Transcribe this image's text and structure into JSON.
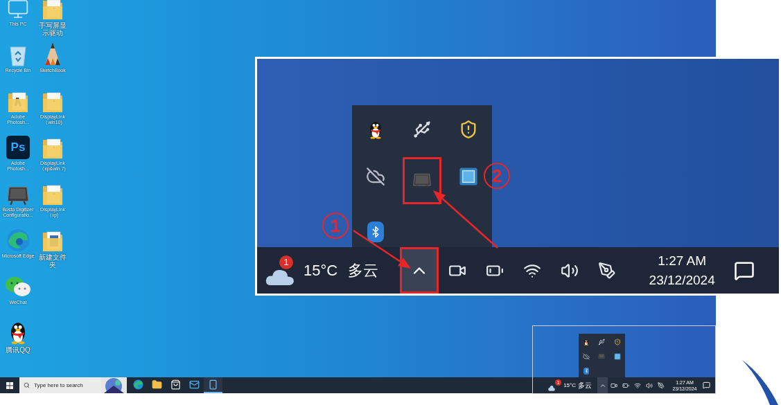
{
  "desktop": {
    "columns": [
      [
        {
          "kind": "pc",
          "label": "This PC"
        },
        {
          "kind": "bin",
          "label": "Recycle Bin"
        },
        {
          "kind": "folder-doc",
          "label": "Adobe Photosh..."
        },
        {
          "kind": "ps",
          "glyph": "Ps",
          "label": "Adobe Photosh..."
        },
        {
          "kind": "tablet",
          "label": "Bosto Digitizer Configuratio..."
        },
        {
          "kind": "edge",
          "label": "Microsoft Edge"
        },
        {
          "kind": "wechat",
          "label": "WeChat"
        },
        {
          "kind": "qq",
          "label": "腾讯QQ"
        }
      ],
      [
        {
          "kind": "folder",
          "label": "手写屏显示驱动"
        },
        {
          "kind": "sketch",
          "label": "SketchBook"
        },
        {
          "kind": "folder",
          "label": "DisplayLink（win10)"
        },
        {
          "kind": "folder",
          "label": "DisplayLink（xp&win 7)"
        },
        {
          "kind": "folder",
          "label": "DisplayLink（xp)"
        },
        {
          "kind": "folder-pics",
          "label": "新建文件夹"
        }
      ]
    ]
  },
  "taskbar": {
    "search": {
      "placeholder": "Type here to search"
    },
    "pinned": [
      {
        "kind": "edge",
        "active": false
      },
      {
        "kind": "explorer",
        "active": false
      },
      {
        "kind": "store",
        "active": false
      },
      {
        "kind": "mail",
        "active": false
      },
      {
        "kind": "phone",
        "active": true
      }
    ],
    "tray": {
      "badge": "1",
      "temperature": "15°C",
      "condition": "多云",
      "time": "1:27 AM",
      "date": "23/12/2024",
      "chevron_highlighted": false
    },
    "overflow": [
      {
        "kind": "qq",
        "highlighted": false
      },
      {
        "kind": "usb",
        "highlighted": false
      },
      {
        "kind": "shield",
        "highlighted": false
      },
      {
        "kind": "cloud-off",
        "highlighted": false
      },
      {
        "kind": "tablet",
        "highlighted": false
      },
      {
        "kind": "app",
        "highlighted": false
      },
      {
        "kind": "bluetooth",
        "highlighted": false
      }
    ]
  },
  "zoom_inset": {
    "overflow": [
      {
        "kind": "qq",
        "highlighted": false
      },
      {
        "kind": "usb",
        "highlighted": false
      },
      {
        "kind": "shield",
        "highlighted": false
      },
      {
        "kind": "cloud-off",
        "highlighted": false
      },
      {
        "kind": "tablet",
        "highlighted": true
      },
      {
        "kind": "app",
        "highlighted": false
      },
      {
        "kind": "bluetooth",
        "highlighted": false
      }
    ],
    "tray": {
      "badge": "1",
      "temperature": "15°C",
      "condition": "多云",
      "time": "1:27 AM",
      "date": "23/12/2024",
      "chevron_highlighted": true
    },
    "steps": [
      {
        "label": "1"
      },
      {
        "label": "2"
      }
    ]
  }
}
